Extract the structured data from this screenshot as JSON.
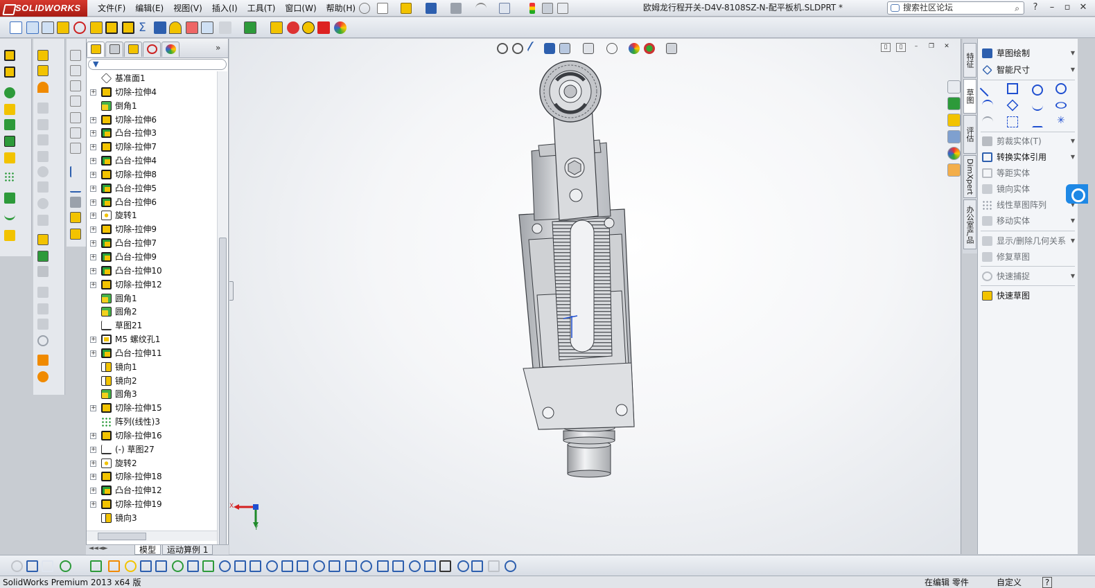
{
  "app": {
    "logo": "SOLIDWORKS",
    "document_title": "欧姆龙行程开关-D4V-8108SZ-N-配平板机.SLDPRT *"
  },
  "menu": [
    "文件(F)",
    "编辑(E)",
    "视图(V)",
    "插入(I)",
    "工具(T)",
    "窗口(W)",
    "帮助(H)"
  ],
  "search": {
    "placeholder": "搜索社区论坛"
  },
  "window_controls": {
    "help": "?",
    "minimize": "–",
    "restore": "▫",
    "close": "✕"
  },
  "feature_tree": {
    "filter_icon": "filter-icon",
    "items": [
      {
        "label": "基准面1",
        "icon": "plane",
        "expandable": false
      },
      {
        "label": "切除-拉伸4",
        "icon": "cut",
        "expandable": true
      },
      {
        "label": "倒角1",
        "icon": "fillet",
        "expandable": false
      },
      {
        "label": "切除-拉伸6",
        "icon": "cut",
        "expandable": true
      },
      {
        "label": "凸台-拉伸3",
        "icon": "boss",
        "expandable": true
      },
      {
        "label": "切除-拉伸7",
        "icon": "cut",
        "expandable": true
      },
      {
        "label": "凸台-拉伸4",
        "icon": "boss",
        "expandable": true
      },
      {
        "label": "切除-拉伸8",
        "icon": "cut",
        "expandable": true
      },
      {
        "label": "凸台-拉伸5",
        "icon": "boss",
        "expandable": true
      },
      {
        "label": "凸台-拉伸6",
        "icon": "boss",
        "expandable": true
      },
      {
        "label": "旋转1",
        "icon": "revolve",
        "expandable": true
      },
      {
        "label": "切除-拉伸9",
        "icon": "cut",
        "expandable": true
      },
      {
        "label": "凸台-拉伸7",
        "icon": "boss",
        "expandable": true
      },
      {
        "label": "凸台-拉伸9",
        "icon": "boss",
        "expandable": true
      },
      {
        "label": "凸台-拉伸10",
        "icon": "boss",
        "expandable": true
      },
      {
        "label": "切除-拉伸12",
        "icon": "cut",
        "expandable": true
      },
      {
        "label": "圆角1",
        "icon": "fillet",
        "expandable": false
      },
      {
        "label": "圆角2",
        "icon": "fillet",
        "expandable": false
      },
      {
        "label": "草图21",
        "icon": "sketch",
        "expandable": false
      },
      {
        "label": "M5 螺纹孔1",
        "icon": "hole",
        "expandable": true
      },
      {
        "label": "凸台-拉伸11",
        "icon": "boss",
        "expandable": true
      },
      {
        "label": "镜向1",
        "icon": "mirror",
        "expandable": false
      },
      {
        "label": "镜向2",
        "icon": "mirror",
        "expandable": false
      },
      {
        "label": "圆角3",
        "icon": "fillet",
        "expandable": false
      },
      {
        "label": "切除-拉伸15",
        "icon": "cut",
        "expandable": true
      },
      {
        "label": "阵列(线性)3",
        "icon": "pattern",
        "expandable": false
      },
      {
        "label": "切除-拉伸16",
        "icon": "cut",
        "expandable": true
      },
      {
        "label": "(-) 草图27",
        "icon": "sketch",
        "expandable": true
      },
      {
        "label": "旋转2",
        "icon": "revolve",
        "expandable": true
      },
      {
        "label": "切除-拉伸18",
        "icon": "cut",
        "expandable": true
      },
      {
        "label": "凸台-拉伸12",
        "icon": "boss",
        "expandable": true
      },
      {
        "label": "切除-拉伸19",
        "icon": "cut",
        "expandable": true
      },
      {
        "label": "镜向3",
        "icon": "mirror",
        "expandable": false
      }
    ],
    "bottom_tabs": [
      "模型",
      "运动算例 1"
    ]
  },
  "task_pane_tabs": [
    "特征",
    "草图",
    "评估",
    "DimXpert",
    "办公室产品"
  ],
  "sketch_commands": [
    {
      "label": "草图绘制",
      "enabled": true,
      "dropdown": true
    },
    {
      "label": "智能尺寸",
      "enabled": true,
      "dropdown": true
    },
    {
      "label": "剪裁实体(T)",
      "enabled": false,
      "dropdown": true
    },
    {
      "label": "转换实体引用",
      "enabled": true,
      "dropdown": true
    },
    {
      "label": "等距实体",
      "enabled": false,
      "dropdown": false
    },
    {
      "label": "镜向实体",
      "enabled": false,
      "dropdown": false
    },
    {
      "label": "线性草图阵列",
      "enabled": false,
      "dropdown": true
    },
    {
      "label": "移动实体",
      "enabled": false,
      "dropdown": true
    },
    {
      "label": "显示/删除几何关系",
      "enabled": false,
      "dropdown": true
    },
    {
      "label": "修复草图",
      "enabled": false,
      "dropdown": false
    },
    {
      "label": "快速捕捉",
      "enabled": false,
      "dropdown": true
    },
    {
      "label": "快速草图",
      "enabled": true,
      "dropdown": false
    }
  ],
  "triad": {
    "x_label": "X",
    "y_label": "Y"
  },
  "status": {
    "product": "SolidWorks Premium 2013 x64 版",
    "mode": "在编辑 零件",
    "custom": "自定义",
    "help": "?"
  },
  "colors": {
    "logo_red": "#c0271d",
    "feature_yellow": "#f2c300",
    "accent_blue": "#1e88e5",
    "triad_red": "#d42020",
    "triad_green": "#1f8a2a"
  }
}
